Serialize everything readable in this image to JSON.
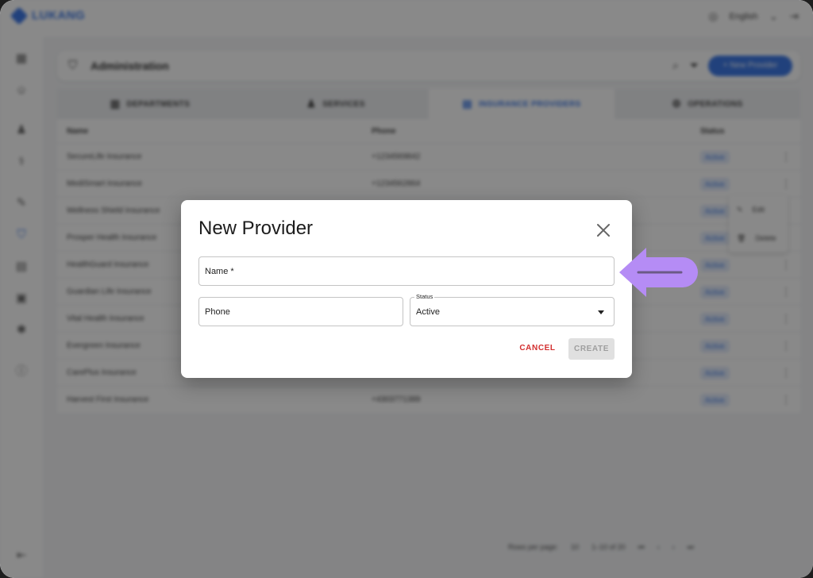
{
  "app": {
    "logo_text": "LUKANG",
    "language": "English"
  },
  "admin": {
    "title": "Administration",
    "new_button_label": "+ New Provider"
  },
  "tabs": [
    {
      "label": "DEPARTMENTS",
      "icon": "building-icon",
      "active": false
    },
    {
      "label": "SERVICES",
      "icon": "people-icon",
      "active": false
    },
    {
      "label": "INSURANCE PROVIDERS",
      "icon": "id-card-icon",
      "active": true
    },
    {
      "label": "OPERATIONS",
      "icon": "gear-icon",
      "active": false
    }
  ],
  "table": {
    "headers": {
      "name": "Name",
      "phone": "Phone",
      "status": "Status"
    },
    "rows": [
      {
        "name": "SecureLife Insurance",
        "phone": "+1234569842",
        "status": "Active"
      },
      {
        "name": "MediSmart Insurance",
        "phone": "+1234562864",
        "status": "Active"
      },
      {
        "name": "Wellness Shield Insurance",
        "phone": "",
        "status": "Active"
      },
      {
        "name": "Prosper Health Insurance",
        "phone": "",
        "status": "Active"
      },
      {
        "name": "HealthGuard Insurance",
        "phone": "",
        "status": "Active"
      },
      {
        "name": "Guardian Life Insurance",
        "phone": "",
        "status": "Active"
      },
      {
        "name": "Vital Health Insurance",
        "phone": "",
        "status": "Active"
      },
      {
        "name": "Evergreen Insurance",
        "phone": "",
        "status": "Active"
      },
      {
        "name": "CarePlus Insurance",
        "phone": "",
        "status": "Active"
      },
      {
        "name": "Harvest First Insurance",
        "phone": "+4303771389",
        "status": "Active"
      }
    ],
    "context_menu": {
      "edit": "Edit",
      "delete": "Delete"
    }
  },
  "pagination": {
    "rows_per_page_label": "Rows per page:",
    "rows_per_page": "10",
    "range": "1–10 of 20"
  },
  "dialog": {
    "title": "New Provider",
    "name_label": "Name *",
    "phone_label": "Phone",
    "status_label": "Status",
    "status_value": "Active",
    "cancel_label": "CANCEL",
    "create_label": "CREATE"
  },
  "colors": {
    "accent": "#2f6fe4",
    "cancel": "#d32f2f",
    "arrow": "#b58cf5"
  }
}
